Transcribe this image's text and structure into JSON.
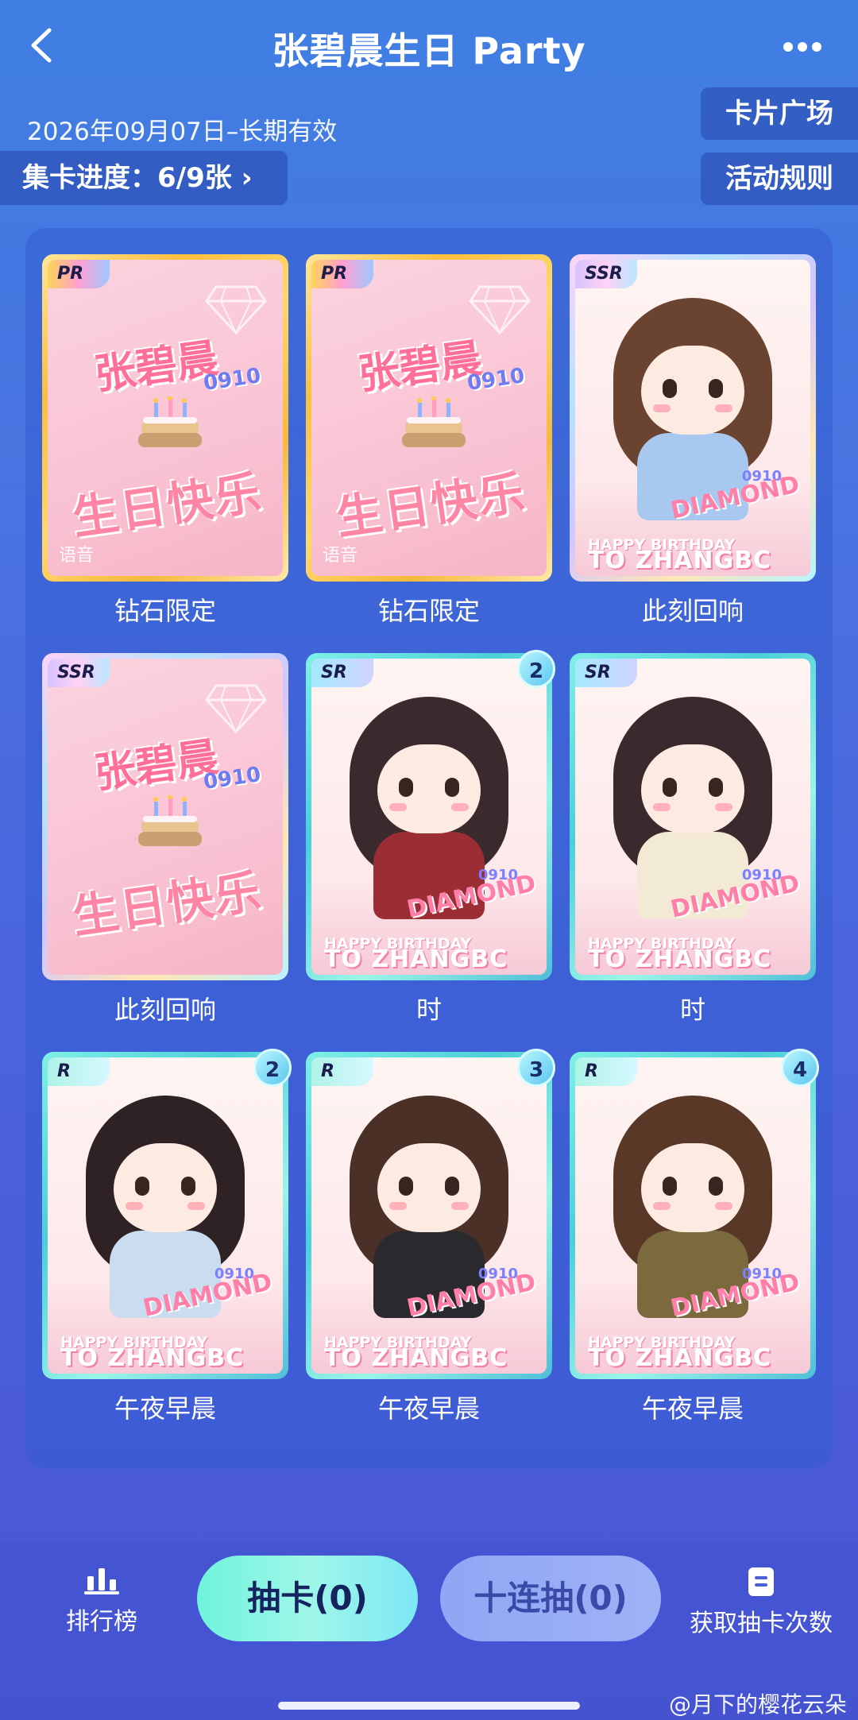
{
  "header": {
    "title": "张碧晨生日 Party",
    "date_range": "2026年09月07日–长期有效",
    "progress_label": "集卡进度：6/9张",
    "progress_chevron": "›",
    "card_gallery_label": "卡片广场",
    "rules_label": "活动规则"
  },
  "cards": [
    {
      "rarity": "PR",
      "caption": "钻石限定",
      "kind": "birthday",
      "voice": "语音",
      "name": "张碧晨",
      "num": "0910",
      "text": "生日快乐",
      "badge": ""
    },
    {
      "rarity": "PR",
      "caption": "钻石限定",
      "kind": "birthday",
      "voice": "语音",
      "name": "张碧晨",
      "num": "0910",
      "text": "生日快乐",
      "badge": ""
    },
    {
      "rarity": "SSR",
      "caption": "此刻回响",
      "kind": "chibi",
      "dress_color": "#a9c8f0",
      "hair_color": "#6b4331",
      "diamond": "DIAMOND",
      "num": "0910",
      "hb1": "HAPPY BIRTHDAY",
      "hb2": "TO ZHANGBC",
      "badge": ""
    },
    {
      "rarity": "SSR",
      "caption": "此刻回响",
      "kind": "birthday",
      "voice": "",
      "name": "张碧晨",
      "num": "0910",
      "text": "生日快乐",
      "badge": ""
    },
    {
      "rarity": "SR",
      "caption": "时",
      "kind": "chibi",
      "dress_color": "#9b2d35",
      "hair_color": "#3a2a2d",
      "diamond": "DIAMOND",
      "num": "0910",
      "hb1": "HAPPY BIRTHDAY",
      "hb2": "TO ZHANGBC",
      "badge": "2"
    },
    {
      "rarity": "SR",
      "caption": "时",
      "kind": "chibi",
      "dress_color": "#f3ead6",
      "hair_color": "#3a2a2d",
      "diamond": "DIAMOND",
      "num": "0910",
      "hb1": "HAPPY BIRTHDAY",
      "hb2": "TO ZHANGBC",
      "badge": ""
    },
    {
      "rarity": "R",
      "caption": "午夜早晨",
      "kind": "chibi",
      "dress_color": "#c9dcf0",
      "hair_color": "#2e2224",
      "diamond": "DIAMOND",
      "num": "0910",
      "hb1": "HAPPY BIRTHDAY",
      "hb2": "TO ZHANGBC",
      "badge": "2"
    },
    {
      "rarity": "R",
      "caption": "午夜早晨",
      "kind": "chibi",
      "dress_color": "#2a2a2e",
      "hair_color": "#4a3026",
      "diamond": "DIAMOND",
      "num": "0910",
      "hb1": "HAPPY BIRTHDAY",
      "hb2": "TO ZHANGBC",
      "badge": "3"
    },
    {
      "rarity": "R",
      "caption": "午夜早晨",
      "kind": "chibi",
      "dress_color": "#7a6a3e",
      "hair_color": "#5a3828",
      "diamond": "DIAMOND",
      "num": "0910",
      "hb1": "HAPPY BIRTHDAY",
      "hb2": "TO ZHANGBC",
      "badge": "4"
    }
  ],
  "bottom": {
    "rank_label": "排行榜",
    "draw_label": "抽卡(0)",
    "draw10_label": "十连抽(0)",
    "get_draws_label": "获取抽卡次数"
  },
  "watermark": "@月下的樱花云朵"
}
